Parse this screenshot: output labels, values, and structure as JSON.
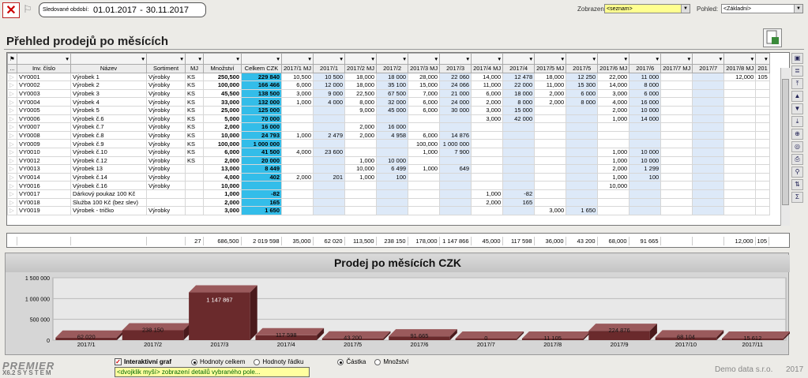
{
  "header": {
    "period_label": "Sledované období:",
    "period_from": "01.01.2017",
    "period_sep": "-",
    "period_to": "30.11.2017",
    "view_label": "Zobrazení:",
    "view_value": "<seznam>",
    "look_label": "Pohled:",
    "look_value": "<Základní>"
  },
  "title": "Přehled prodejů po měsících",
  "columns": [
    "...",
    "Inv. číslo",
    "Název",
    "Sortiment",
    "MJ",
    "Množství",
    "Celkem CZK",
    "2017/1 MJ",
    "2017/1",
    "2017/2 MJ",
    "2017/2",
    "2017/3 MJ",
    "2017/3",
    "2017/4 MJ",
    "2017/4",
    "2017/5 MJ",
    "2017/5",
    "2017/6 MJ",
    "2017/6",
    "2017/7 MJ",
    "2017/7",
    "2017/8 MJ",
    "201"
  ],
  "rows": [
    [
      "VY0001",
      "Výrobek 1",
      "Výrobky",
      "KS",
      "250,500",
      "229 840",
      "10,500",
      "10 500",
      "18,000",
      "18 000",
      "28,000",
      "22 060",
      "14,000",
      "12 478",
      "18,000",
      "12 250",
      "22,000",
      "11 000",
      "",
      "",
      "12,000",
      "105"
    ],
    [
      "VY0002",
      "Výrobek 2",
      "Výrobky",
      "KS",
      "100,000",
      "166 466",
      "6,000",
      "12 000",
      "18,000",
      "35 100",
      "15,000",
      "24 066",
      "11,000",
      "22 000",
      "11,000",
      "15 300",
      "14,000",
      "8 000",
      "",
      "",
      "",
      ""
    ],
    [
      "VY0003",
      "Výrobek 3",
      "Výrobky",
      "KS",
      "45,500",
      "138 500",
      "3,000",
      "9 000",
      "22,500",
      "67 500",
      "7,000",
      "21 000",
      "6,000",
      "18 000",
      "2,000",
      "6 000",
      "3,000",
      "6 000",
      "",
      "",
      "",
      ""
    ],
    [
      "VY0004",
      "Výrobek 4",
      "Výrobky",
      "KS",
      "33,000",
      "132 000",
      "1,000",
      "4 000",
      "8,000",
      "32 000",
      "6,000",
      "24 000",
      "2,000",
      "8 000",
      "2,000",
      "8 000",
      "4,000",
      "16 000",
      "",
      "",
      "",
      ""
    ],
    [
      "VY0005",
      "Výrobek 5",
      "Výrobky",
      "KS",
      "25,000",
      "125 000",
      "",
      "",
      "9,000",
      "45 000",
      "6,000",
      "30 000",
      "3,000",
      "15 000",
      "",
      "",
      "2,000",
      "10 000",
      "",
      "",
      "",
      ""
    ],
    [
      "VY0006",
      "Výrobek č.6",
      "Výrobky",
      "KS",
      "5,000",
      "70 000",
      "",
      "",
      "",
      "",
      "",
      "",
      "3,000",
      "42 000",
      "",
      "",
      "1,000",
      "14 000",
      "",
      "",
      "",
      ""
    ],
    [
      "VY0007",
      "Výrobek č.7",
      "Výrobky",
      "KS",
      "2,000",
      "16 000",
      "",
      "",
      "2,000",
      "16 000",
      "",
      "",
      "",
      "",
      "",
      "",
      "",
      "",
      "",
      "",
      "",
      ""
    ],
    [
      "VY0008",
      "Výrobek č.8",
      "Výrobky",
      "KS",
      "10,000",
      "24 793",
      "1,000",
      "2 479",
      "2,000",
      "4 958",
      "6,000",
      "14 876",
      "",
      "",
      "",
      "",
      "",
      "",
      "",
      "",
      "",
      ""
    ],
    [
      "VY0009",
      "Výrobek č.9",
      "Výrobky",
      "KS",
      "100,000",
      "1 000 000",
      "",
      "",
      "",
      "",
      "100,000",
      "1 000 000",
      "",
      "",
      "",
      "",
      "",
      "",
      "",
      "",
      "",
      ""
    ],
    [
      "VY0010",
      "Výrobek č.10",
      "Výrobky",
      "KS",
      "6,000",
      "41 500",
      "4,000",
      "23 600",
      "",
      "",
      "1,000",
      "7 900",
      "",
      "",
      "",
      "",
      "1,000",
      "10 000",
      "",
      "",
      "",
      ""
    ],
    [
      "VY0012",
      "Výrobek č.12",
      "Výrobky",
      "KS",
      "2,000",
      "20 000",
      "",
      "",
      "1,000",
      "10 000",
      "",
      "",
      "",
      "",
      "",
      "",
      "1,000",
      "10 000",
      "",
      "",
      "",
      ""
    ],
    [
      "VY0013",
      "Výrobek 13",
      "Výrobky",
      "",
      "13,000",
      "8 449",
      "",
      "",
      "10,000",
      "6 499",
      "1,000",
      "649",
      "",
      "",
      "",
      "",
      "2,000",
      "1 299",
      "",
      "",
      "",
      ""
    ],
    [
      "VY0014",
      "Výrobek č.14",
      "Výrobky",
      "",
      "4,000",
      "402",
      "2,000",
      "201",
      "1,000",
      "100",
      "",
      "",
      "",
      "",
      "",
      "",
      "1,000",
      "100",
      "",
      "",
      "",
      ""
    ],
    [
      "VY0016",
      "Výrobek č.16",
      "Výrobky",
      "",
      "10,000",
      "",
      "",
      "",
      "",
      "",
      "",
      "",
      "",
      "",
      "",
      "",
      "10,000",
      "",
      "",
      "",
      "",
      ""
    ],
    [
      "VY0017",
      "Dárkový poukaz 100 Kč",
      "",
      "",
      "1,000",
      "-82",
      "",
      "",
      "",
      "",
      "",
      "",
      "1,000",
      "-82",
      "",
      "",
      "",
      "",
      "",
      "",
      "",
      ""
    ],
    [
      "VY0018",
      "Služba 100 Kč (bez slev)",
      "",
      "",
      "2,000",
      "165",
      "",
      "",
      "",
      "",
      "",
      "",
      "2,000",
      "165",
      "",
      "",
      "",
      "",
      "",
      "",
      "",
      ""
    ],
    [
      "VY0019",
      "Výrobek - tričko",
      "Výrobky",
      "",
      "3,000",
      "1 650",
      "",
      "",
      "",
      "",
      "",
      "",
      "",
      "",
      "3,000",
      "1 650",
      "",
      "",
      "",
      "",
      "",
      ""
    ]
  ],
  "summary": {
    "count": "27",
    "mnozstvi": "686,500",
    "celkem": "2 019 598",
    "m1mj": "35,000",
    "m1": "62 020",
    "m2mj": "113,500",
    "m2": "238 150",
    "m3mj": "178,000",
    "m3": "1 147 866",
    "m4mj": "45,000",
    "m4": "117 598",
    "m5mj": "36,000",
    "m5": "43 200",
    "m6mj": "68,000",
    "m6": "91 665",
    "m8mj": "12,000",
    "m8": "105"
  },
  "chart_data": {
    "type": "bar",
    "title": "Prodej po měsících CZK",
    "categories": [
      "2017/1",
      "2017/2",
      "2017/3",
      "2017/4",
      "2017/5",
      "2017/6",
      "2017/7",
      "2017/8",
      "2017/9",
      "2017/10",
      "2017/11"
    ],
    "values": [
      62020,
      238150,
      1147867,
      117598,
      43200,
      91665,
      0,
      11105,
      224876,
      68104,
      15612
    ],
    "value_labels": [
      "62 020",
      "238 150",
      "1 147 867",
      "117 598",
      "43 200",
      "91 665",
      "0",
      "11 105",
      "224 876",
      "68 104",
      "15 612"
    ],
    "yticks": [
      "0",
      "500 000",
      "1 000 000",
      "1 500 000"
    ],
    "ylim": [
      0,
      1500000
    ],
    "color": "#6a2a2c"
  },
  "footer": {
    "interactive_label": "Interaktivní graf",
    "radio_total": "Hodnoty celkem",
    "radio_row": "Hodnoty řádku",
    "radio_amount": "Částka",
    "radio_qty": "Množství",
    "hint": "<dvojklik myší> zobrazení detailů vybraného pole...",
    "company": "Demo data s.r.o.",
    "year": "2017",
    "logo": "PREMIER",
    "logo_sub": "SYSTEM",
    "version": "X6.2"
  }
}
